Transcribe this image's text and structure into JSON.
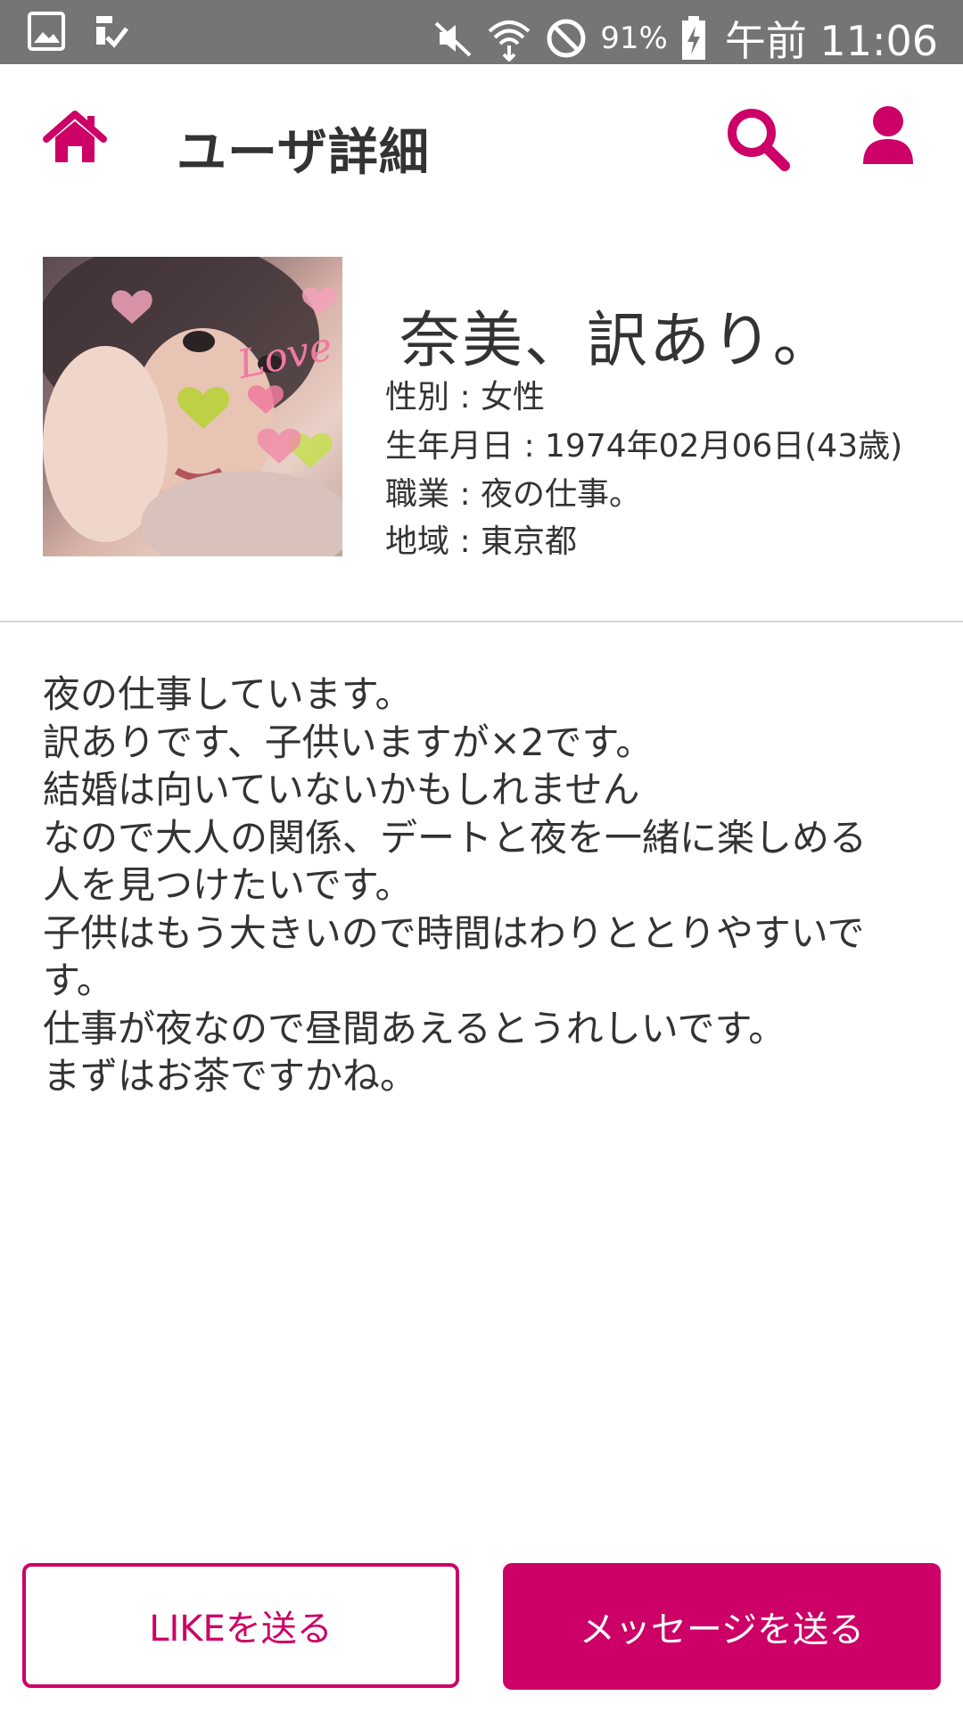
{
  "status_bar": {
    "battery_percent": "91%",
    "time": "午前 11:06",
    "icons": [
      "image-icon",
      "download-done-icon",
      "mute-icon",
      "wifi-icon",
      "block-icon",
      "battery-charging-icon"
    ]
  },
  "header": {
    "title": "ユーザ詳細",
    "icons": [
      "home-icon",
      "search-icon",
      "user-icon"
    ],
    "accent_color": "#cc0066"
  },
  "profile": {
    "name": "奈美、訳あり。",
    "photo_text": "Love",
    "gender_label": "性別",
    "gender": "女性",
    "birthday_label": "生年月日",
    "birthday": "1974年02月06日(43歳)",
    "job_label": "職業",
    "job": "夜の仕事。",
    "region_label": "地域",
    "region": "東京都"
  },
  "bio": {
    "lines": [
      "夜の仕事しています。",
      "訳ありです、子供いますが×2です。",
      "結婚は向いていないかもしれません",
      "なので大人の関係、デートと夜を一緒に楽しめる",
      "人を見つけたいです。",
      "子供はもう大きいので時間はわりととりやすいで",
      "す。",
      "仕事が夜なので昼間あえるとうれしいです。",
      "まずはお茶ですかね。"
    ]
  },
  "actions": {
    "like_label": "LIKEを送る",
    "message_label": "メッセージを送る"
  }
}
